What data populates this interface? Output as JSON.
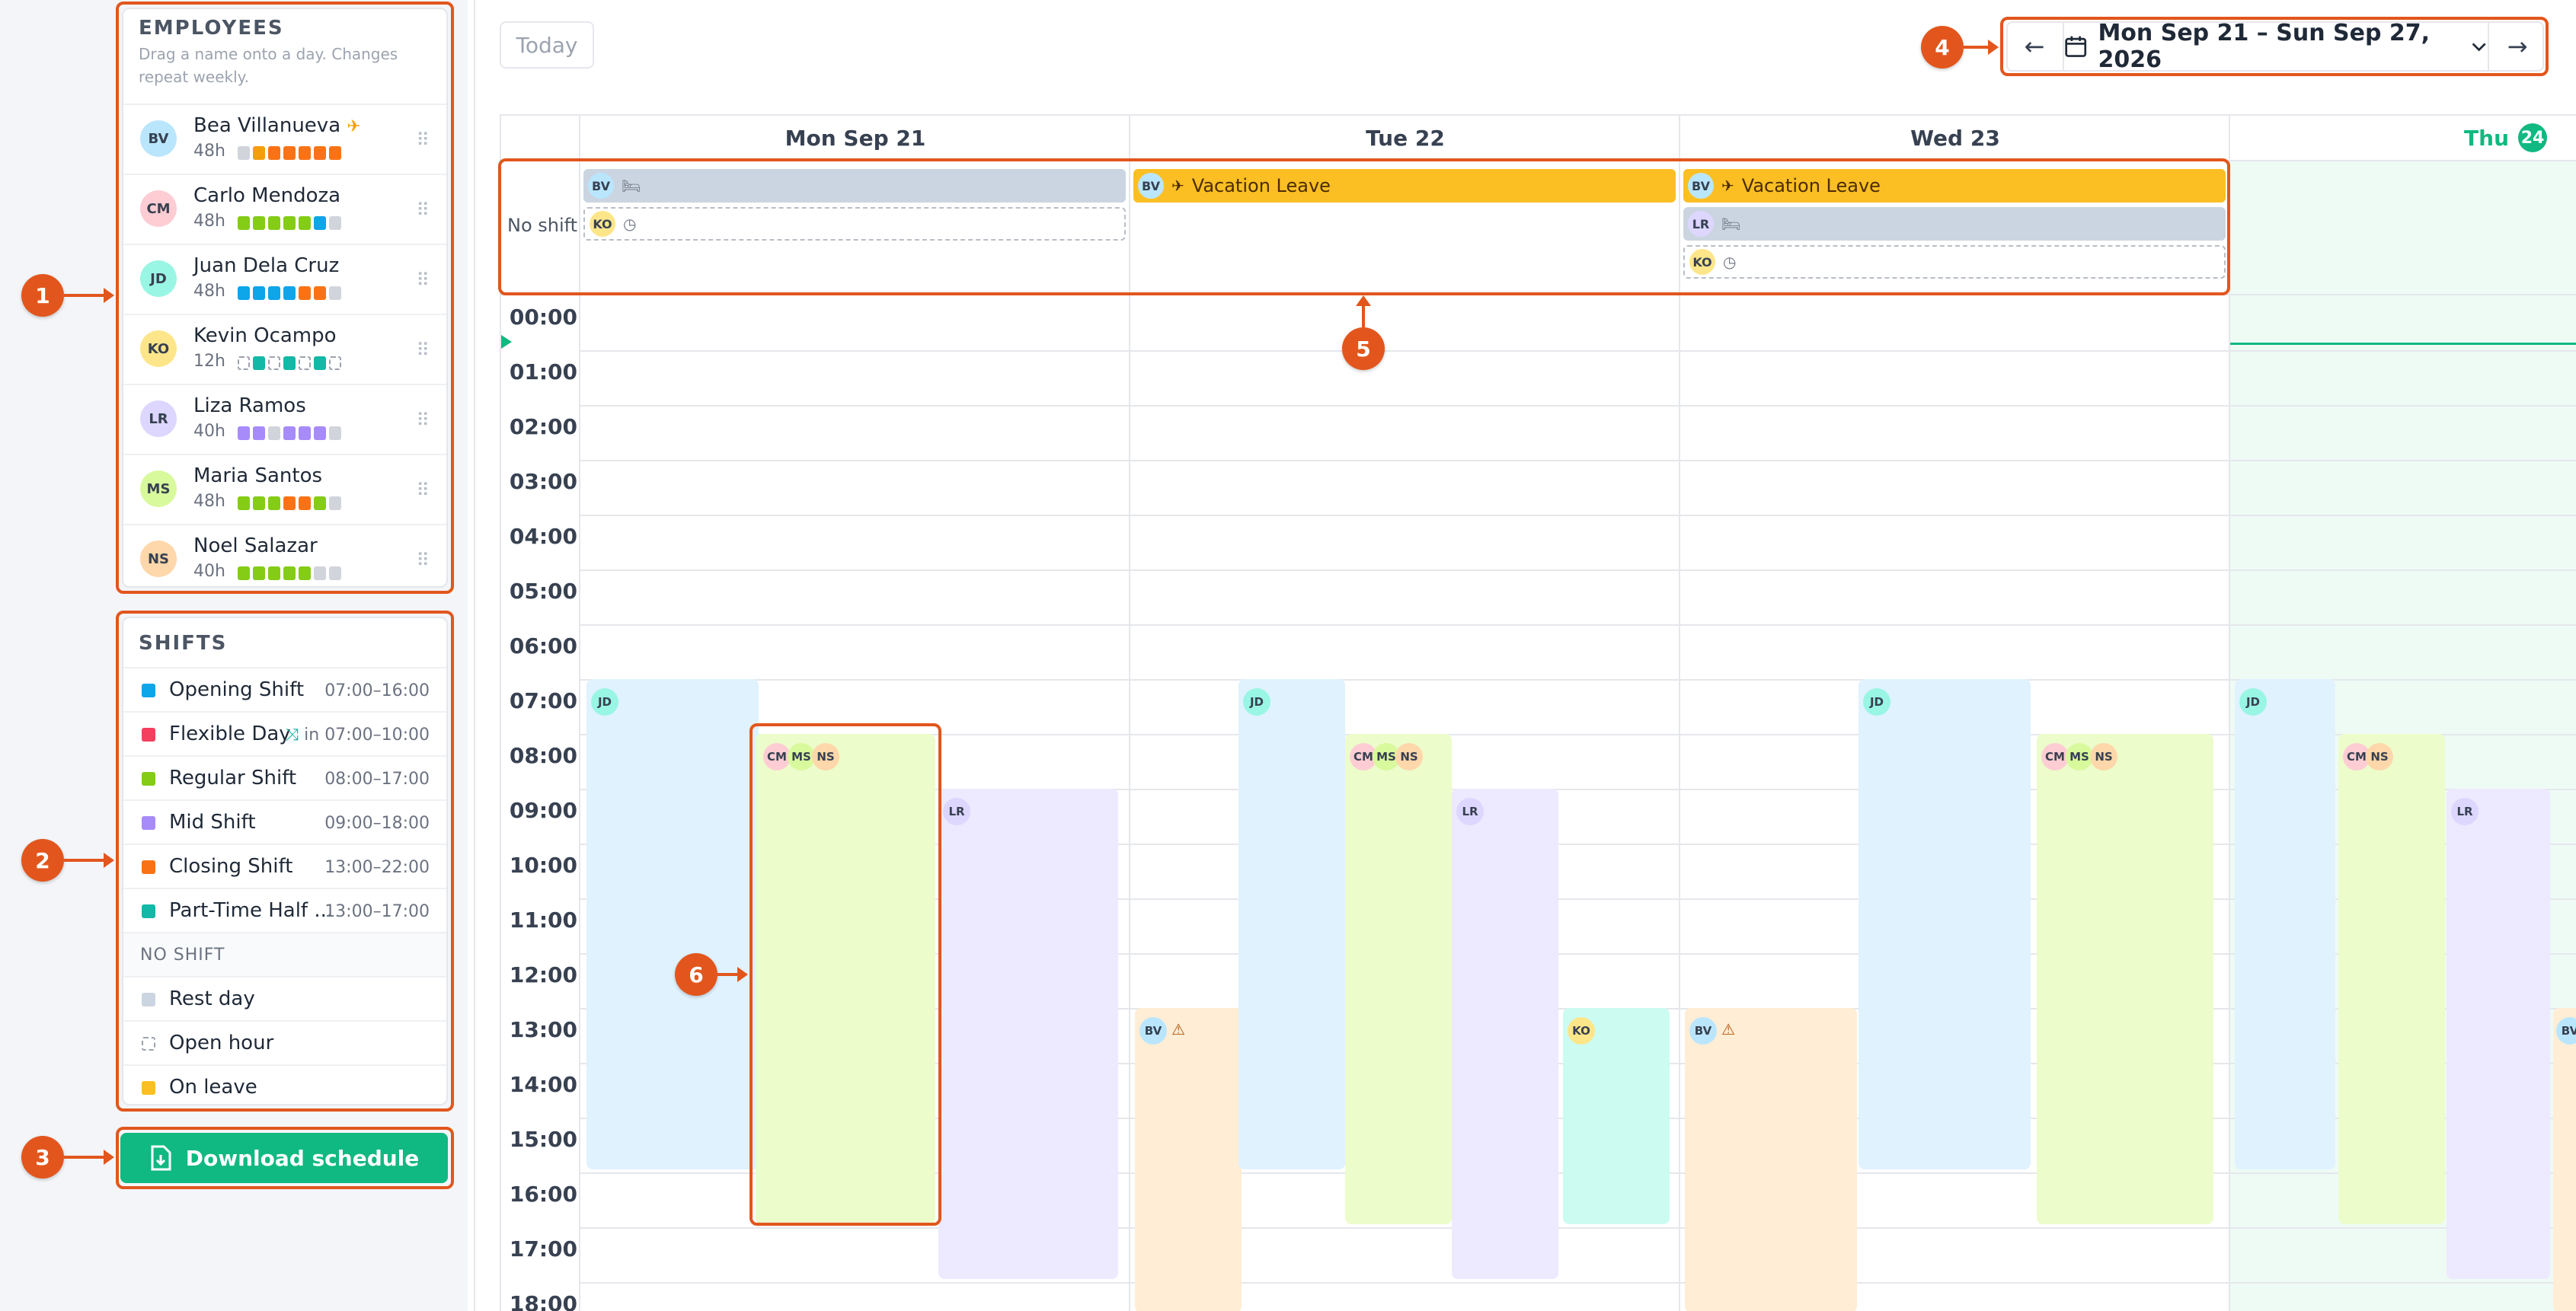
{
  "employees": {
    "title": "EMPLOYEES",
    "hint_line1": "Drag a name onto a day. Changes",
    "hint_line2": "repeat weekly.",
    "items": [
      {
        "initials": "BV",
        "name": "Bea Villanueva",
        "hours": "48h",
        "avatar_color": "#bae6fd",
        "badge": "plane-icon",
        "days": [
          "#d1d5db",
          "#f59e0b",
          "#f97316",
          "#f97316",
          "#f97316",
          "#f97316",
          "#f97316"
        ]
      },
      {
        "initials": "CM",
        "name": "Carlo Mendoza",
        "hours": "48h",
        "avatar_color": "#fecdd3",
        "days": [
          "#84cc16",
          "#84cc16",
          "#84cc16",
          "#84cc16",
          "#84cc16",
          "#0ea5e9",
          "#d1d5db"
        ]
      },
      {
        "initials": "JD",
        "name": "Juan Dela Cruz",
        "hours": "48h",
        "avatar_color": "#99f6e4",
        "days": [
          "#0ea5e9",
          "#0ea5e9",
          "#0ea5e9",
          "#0ea5e9",
          "#f97316",
          "#f97316",
          "#d1d5db"
        ]
      },
      {
        "initials": "KO",
        "name": "Kevin Ocampo",
        "hours": "12h",
        "avatar_color": "#fde68a",
        "days": [
          "open",
          "#14b8a6",
          "open",
          "#14b8a6",
          "open",
          "#14b8a6",
          "open"
        ]
      },
      {
        "initials": "LR",
        "name": "Liza Ramos",
        "hours": "40h",
        "avatar_color": "#ddd6fe",
        "days": [
          "#a78bfa",
          "#a78bfa",
          "#d1d5db",
          "#a78bfa",
          "#a78bfa",
          "#a78bfa",
          "#d1d5db"
        ]
      },
      {
        "initials": "MS",
        "name": "Maria Santos",
        "hours": "48h",
        "avatar_color": "#d9f99d",
        "days": [
          "#84cc16",
          "#84cc16",
          "#84cc16",
          "#f97316",
          "#f97316",
          "#84cc16",
          "#d1d5db"
        ]
      },
      {
        "initials": "NS",
        "name": "Noel Salazar",
        "hours": "40h",
        "avatar_color": "#fed7aa",
        "days": [
          "#84cc16",
          "#84cc16",
          "#84cc16",
          "#84cc16",
          "#84cc16",
          "#d1d5db",
          "#d1d5db"
        ]
      }
    ]
  },
  "shifts": {
    "title": "SHIFTS",
    "items": [
      {
        "name": "Opening Shift",
        "time": "07:00–16:00",
        "color": "#0ea5e9"
      },
      {
        "name": "Flexible Day",
        "time": "in 07:00–10:00",
        "color": "#f43f5e",
        "flex": true
      },
      {
        "name": "Regular Shift",
        "time": "08:00–17:00",
        "color": "#84cc16"
      },
      {
        "name": "Mid Shift",
        "time": "09:00–18:00",
        "color": "#a78bfa"
      },
      {
        "name": "Closing Shift",
        "time": "13:00–22:00",
        "color": "#f97316"
      },
      {
        "name": "Part-Time Half ...",
        "time": "13:00–17:00",
        "color": "#14b8a6"
      }
    ],
    "no_shift_title": "NO SHIFT",
    "no_shift_items": [
      {
        "name": "Rest day",
        "type": "rest",
        "color": "#cbd5e1"
      },
      {
        "name": "Open hour",
        "type": "open",
        "color": "#ffffff"
      },
      {
        "name": "On leave",
        "type": "leave",
        "color": "#fbbf24"
      }
    ]
  },
  "download_label": "Download schedule",
  "toolbar": {
    "today_label": "Today",
    "date_range": "Mon Sep 21 – Sun Sep 27, 2026",
    "prev_icon": "arrow-left-icon",
    "next_icon": "arrow-right-icon"
  },
  "calendar": {
    "days": [
      {
        "label": "Mon Sep 21"
      },
      {
        "label": "Tue 22"
      },
      {
        "label": "Wed 23"
      },
      {
        "label": "Thu",
        "today_number": "24",
        "is_today": true
      }
    ],
    "no_shift_label": "No shift",
    "vacation_label": "Vacation Leave",
    "times": [
      "00:00",
      "01:00",
      "02:00",
      "03:00",
      "04:00",
      "05:00",
      "06:00",
      "07:00",
      "08:00",
      "09:00",
      "10:00",
      "11:00",
      "12:00",
      "13:00",
      "14:00",
      "15:00",
      "16:00",
      "17:00",
      "18:00"
    ]
  },
  "annotations": [
    "1",
    "2",
    "3",
    "4",
    "5",
    "6"
  ],
  "colors": {
    "accent": "#e2561d",
    "primary_green": "#10b981",
    "opening": "#e0f2fe",
    "regular": "#ecfccb",
    "mid": "#ede9fe",
    "closing": "#ffedd5",
    "parttime": "#ccfbf1",
    "leave": "#fbbf24",
    "rest": "#cbd5e1"
  }
}
